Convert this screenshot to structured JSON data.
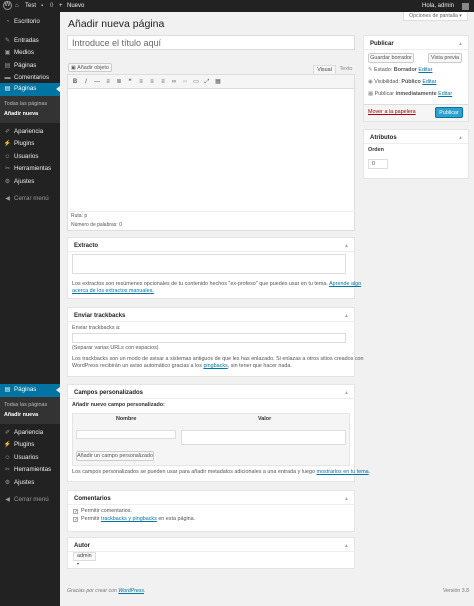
{
  "adminbar": {
    "site": "Test",
    "comments_count": "0",
    "new_label": "Nuevo",
    "greeting": "Hola, admin"
  },
  "sidebar": {
    "top_items": [
      {
        "label": "Escritorio",
        "icon": "dashboard-icon"
      },
      {
        "label": "Entradas",
        "icon": "pin-icon"
      },
      {
        "label": "Medios",
        "icon": "media-icon"
      },
      {
        "label": "Páginas",
        "icon": "page-icon"
      },
      {
        "label": "Comentarios",
        "icon": "comment-icon"
      }
    ],
    "current_label": "Páginas",
    "submenu": [
      "Todas las páginas",
      "Añadir nueva"
    ],
    "bottom_items": [
      {
        "label": "Apariencia",
        "icon": "brush-icon"
      },
      {
        "label": "Plugins",
        "icon": "plugin-icon"
      },
      {
        "label": "Usuarios",
        "icon": "users-icon"
      },
      {
        "label": "Herramientas",
        "icon": "tools-icon"
      },
      {
        "label": "Ajustes",
        "icon": "settings-icon"
      }
    ],
    "collapse_label": "Cerrar menú"
  },
  "main": {
    "screen_options": "Opciones de pantalla",
    "page_title": "Añadir nueva página",
    "title_placeholder": "Introduce el título aquí",
    "add_media": "Añadir objeto",
    "tab_visual": "Visual",
    "tab_text": "Texto",
    "path_label": "Ruta: p",
    "word_count": "Número de palabras: 0"
  },
  "publish": {
    "title": "Publicar",
    "save_draft": "Guardar borrador",
    "preview": "Vista previa",
    "status_label": "Estado:",
    "status_value": "Borrador",
    "visibility_label": "Visibilidad:",
    "visibility_value": "Público",
    "schedule_label": "Publicar",
    "schedule_value": "inmediatamente",
    "edit": "Editar",
    "trash": "Mover a la papelera",
    "publish_button": "Publicar"
  },
  "attributes": {
    "title": "Atributos",
    "order_label": "Orden",
    "order_value": "0"
  },
  "excerpt": {
    "title": "Extracto",
    "help_text": "Los extractos son resúmenes opcionales de tu contenido hechos \"ex-profeso\" que puedes usar en tu tema.",
    "help_link_1": "Aprende algo",
    "help_link_2": "acerca de los extractos manuales."
  },
  "trackbacks": {
    "title": "Enviar trackbacks",
    "label": "Enviar trackbacks a:",
    "hint": "(Separar varias URLs con espacios)",
    "help_1": "Los trackbacks son un modo de avisar a sistemas antiguos de que les has enlazado. Si enlazas a otros sitios creados con",
    "help_2a": "WordPress recibirán un aviso automático gracias a los",
    "help_link": "pingbacks",
    "help_2b": ", sin tener que hacer nada."
  },
  "custom_fields": {
    "title": "Campos personalizados",
    "add_new_label": "Añadir nuevo campo personalizado:",
    "col_name": "Nombre",
    "col_value": "Valor",
    "add_button": "Añadir un campo personalizado",
    "help_a": "Los campos personalizados se pueden usar para añadir metadatos adicionales a una entrada y luego",
    "help_link": "mostrarlos en tu tema",
    "help_b": "."
  },
  "comments": {
    "title": "Comentarios",
    "allow_comments": "Permitir comentarios.",
    "allow_pings_a": "Permitir",
    "allow_pings_link": "trackbacks y pingbacks",
    "allow_pings_b": "en esta página."
  },
  "author": {
    "title": "Autor",
    "value": "admin"
  },
  "footer": {
    "thanks_a": "Gracias por crear con",
    "thanks_link": "WordPress",
    "thanks_b": ".",
    "version": "Versión 3.8"
  },
  "colors": {
    "accent": "#0074a2",
    "primary_button": "#2ea2cc",
    "sidebar_bg": "#222222",
    "trash": "#a00000"
  }
}
